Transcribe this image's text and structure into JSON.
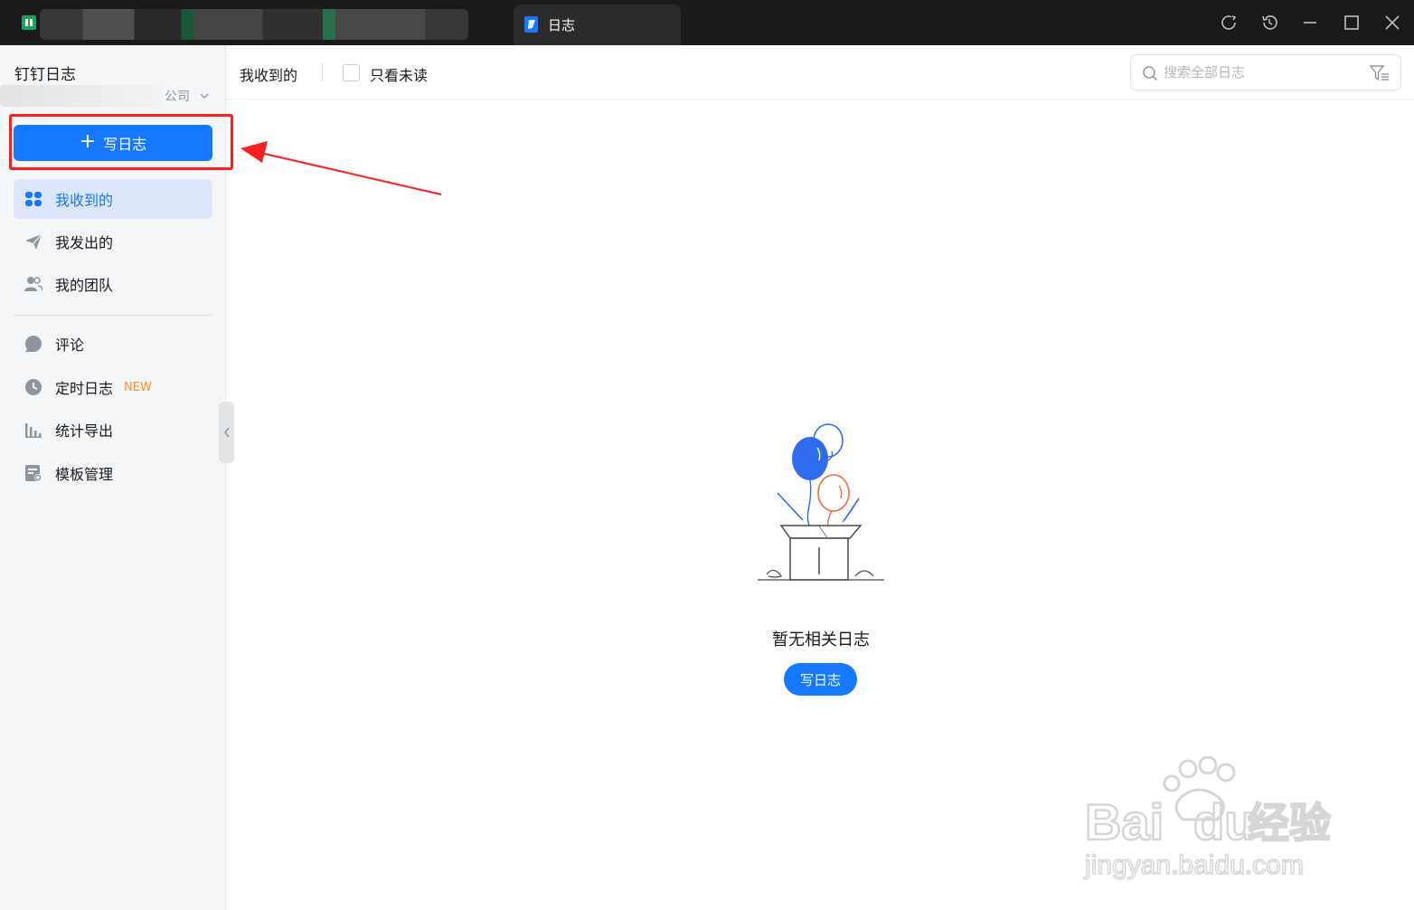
{
  "window": {
    "tab_title": "日志",
    "controls": [
      "sync-icon",
      "history-icon",
      "minimize-icon",
      "maximize-icon",
      "close-icon"
    ]
  },
  "sidebar": {
    "app_title": "钉钉日志",
    "org_suffix": "公司",
    "write_button": {
      "icon": "plus-icon",
      "label": "写日志"
    },
    "nav": [
      {
        "icon": "grid-icon",
        "label": "我收到的",
        "active": true
      },
      {
        "icon": "send-icon",
        "label": "我发出的"
      },
      {
        "icon": "team-icon",
        "label": "我的团队"
      }
    ],
    "nav2": [
      {
        "icon": "comment-icon",
        "label": "评论"
      },
      {
        "icon": "clock-icon",
        "label": "定时日志",
        "badge": "NEW"
      },
      {
        "icon": "chart-icon",
        "label": "统计导出"
      },
      {
        "icon": "template-icon",
        "label": "模板管理"
      }
    ]
  },
  "toolbar": {
    "title": "我收到的",
    "unread_only_label": "只看未读",
    "search_placeholder": "搜索全部日志"
  },
  "empty_state": {
    "message": "暂无相关日志",
    "button_label": "写日志"
  },
  "watermark": {
    "brand": "Bai",
    "brand2": "du",
    "cn": "经验",
    "url": "jingyan.baidu.com"
  },
  "colors": {
    "primary": "#1677ff",
    "highlight": "#ff1d1d",
    "badge": "#ff8c2e",
    "sidebar_bg": "#f5f6f7"
  }
}
